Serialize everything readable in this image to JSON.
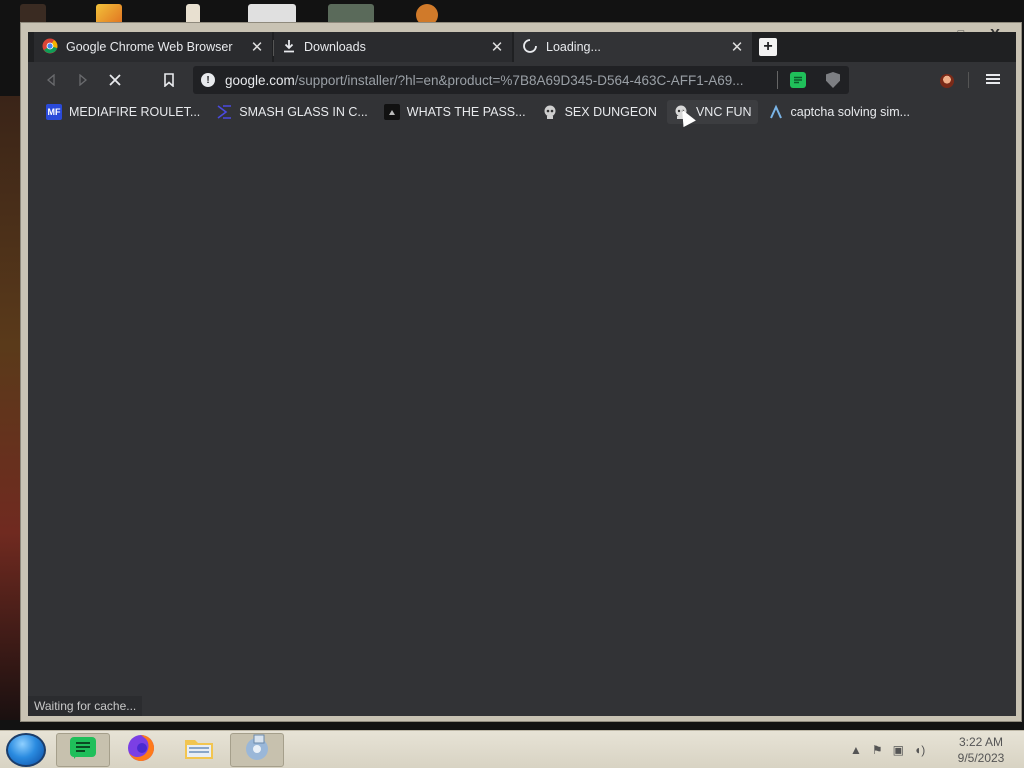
{
  "window": {
    "controls": {
      "minimize": "—",
      "maximize": "□",
      "close": "X"
    }
  },
  "tabs": [
    {
      "title": "Google Chrome Web Browser",
      "icon": "chrome-icon",
      "state": "inactive"
    },
    {
      "title": "Downloads",
      "icon": "download-icon",
      "state": "inactive"
    },
    {
      "title": "Loading...",
      "icon": "loading-spinner-icon",
      "state": "active"
    }
  ],
  "toolbar": {
    "url_host": "google.com",
    "url_path": "/support/installer/?hl=en&product=%7B8A69D345-D564-463C-AFF1-A69..."
  },
  "bookmarks": [
    {
      "label": "MEDIAFIRE ROULET...",
      "icon": "mediafire-icon",
      "color": "#2a4ad9"
    },
    {
      "label": "SMASH GLASS IN C...",
      "icon": "chevron-bookmark-icon",
      "color": "#3a3ad0"
    },
    {
      "label": "WHATS THE PASS...",
      "icon": "lock-bookmark-icon",
      "color": "#111111"
    },
    {
      "label": "SEX DUNGEON",
      "icon": "skull-icon",
      "color": "#bbbbbb"
    },
    {
      "label": "VNC FUN",
      "icon": "robot-icon",
      "color": "#bbbbbb"
    },
    {
      "label": "captcha solving sim...",
      "icon": "lambda-icon",
      "color": "#4a8fd0"
    }
  ],
  "status": {
    "text": "Waiting for cache..."
  },
  "taskbar": {
    "apps": [
      {
        "name": "sheets-app",
        "icon": "sheets-icon"
      },
      {
        "name": "firefox-app",
        "icon": "firefox-icon"
      },
      {
        "name": "explorer-app",
        "icon": "folder-icon"
      },
      {
        "name": "media-app",
        "icon": "media-icon"
      }
    ],
    "clock": {
      "time": "3:22 AM",
      "date": "9/5/2023"
    }
  },
  "colors": {
    "accent_green": "#20c05a",
    "page_bg": "#323336",
    "tabstrip_bg": "#1f2022"
  }
}
